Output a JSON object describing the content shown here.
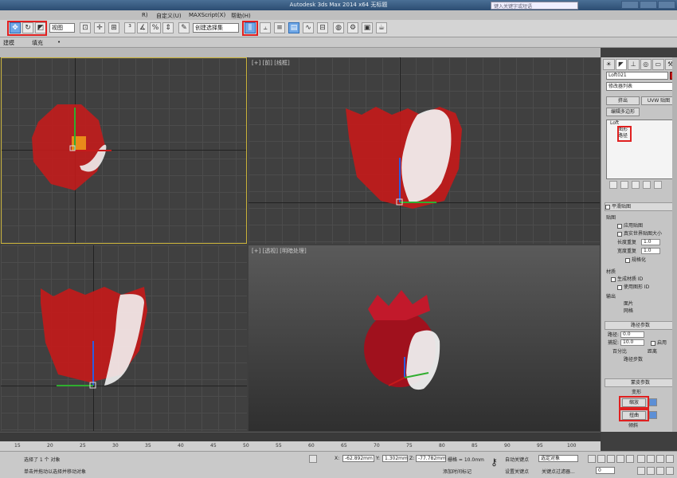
{
  "window": {
    "title": "Autodesk 3ds Max  2014 x64    无标题",
    "search_placeholder": "键入关键字或短语"
  },
  "menu": [
    "R)",
    "自定义(U)",
    "MAXScript(X)",
    "帮助(H)"
  ],
  "toolbar": {
    "selection_filter": "视图",
    "named_selection": "创建选择集"
  },
  "ribbon": {
    "left_label": "建模",
    "mid_label": "填充",
    "dot": "•"
  },
  "viewports": {
    "top": {
      "label": ""
    },
    "front": {
      "label": "[+] [前] [线框]"
    },
    "left": {
      "label": ""
    },
    "perspective": {
      "label": "[+] [透视] [明暗处理]"
    }
  },
  "command_panel": {
    "object_name": "Loft021",
    "modifier_list": "修改器列表",
    "btn_extrude": "挤出",
    "btn_uvw": "UVW 贴图",
    "btn_edit_poly": "编辑多边形",
    "stack": [
      "Loft",
      "图形",
      "路径"
    ],
    "smooth": "平滑贴图",
    "rollout_mapping": "贴图",
    "apply_mapping": "应用贴图",
    "real_world": "真实世界贴图大小",
    "length_repeat": "长度重复",
    "width_repeat": "宽度重复",
    "repeat_value_1": "1.0",
    "repeat_value_2": "1.0",
    "normalize": "规格化",
    "rollout_material": "材质",
    "gen_mat_id": "生成材质 ID",
    "use_shape_id": "使用图形 ID",
    "rollout_output": "输出",
    "output_patch": "面片",
    "output_mesh": "网格",
    "rollout_path": "路径参数",
    "path_label": "路径:",
    "path_value": "0.0",
    "snap_label": "捕捉:",
    "snap_value": "10.0",
    "enable_label": "启用",
    "percent": "百分比",
    "distance": "距离",
    "path_steps": "路径步数",
    "rollout_skin": "蒙皮参数",
    "rollout_deform": "变形",
    "deform_scale": "缩放",
    "deform_twist": "扭曲",
    "deform_teeter": "倾斜"
  },
  "ruler_ticks": [
    "15",
    "20",
    "25",
    "30",
    "35",
    "40",
    "45",
    "50",
    "55",
    "60",
    "65",
    "70",
    "75",
    "80",
    "85",
    "90",
    "95",
    "100"
  ],
  "status": {
    "selected": "选择了 1 个 对象",
    "prompt": "单击并拖动以选择并移动对象",
    "x_value": "-62.892mm",
    "y_value": "1.302mm",
    "z_value": "-77.782mm",
    "grid": "栅格 = 10.0mm",
    "auto_key": "自动关键点",
    "set_key": "设置关键点",
    "selected_obj": "选定对象",
    "key_filters": "关键点过滤器...",
    "add_time_tag": "添加时间标记",
    "frame": "0"
  },
  "colors": {
    "object": "#c51a1a",
    "highlight": "#e02020",
    "active_button": "#6fa7e6"
  }
}
